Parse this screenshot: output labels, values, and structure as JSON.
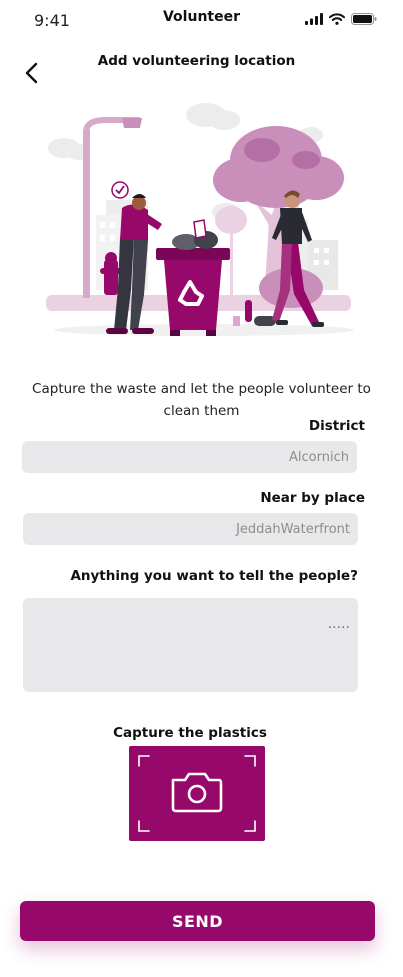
{
  "status_bar": {
    "time": "9:41",
    "title": "Volunteer",
    "icons": [
      "signal-icon",
      "wifi-icon",
      "battery-icon"
    ]
  },
  "header": {
    "title": "Add volunteering  location",
    "back_icon": "chevron-left-icon"
  },
  "illustration": {
    "icon": "recycle-icon"
  },
  "caption": "Capture the waste and let the people volunteer to clean them",
  "form": {
    "district": {
      "label": "District",
      "value": "Alcornich"
    },
    "near_by_place": {
      "label": "Near by place",
      "value": "JeddahWaterfront"
    },
    "message": {
      "label": "Anything you want to tell the people?",
      "placeholder": "....."
    },
    "capture": {
      "label": "Capture the plastics",
      "icon": "camera-icon"
    }
  },
  "actions": {
    "send_label": "SEND"
  },
  "colors": {
    "accent": "#96086a",
    "accent_light": "#c98fba",
    "field_bg": "#e8e8ea"
  }
}
